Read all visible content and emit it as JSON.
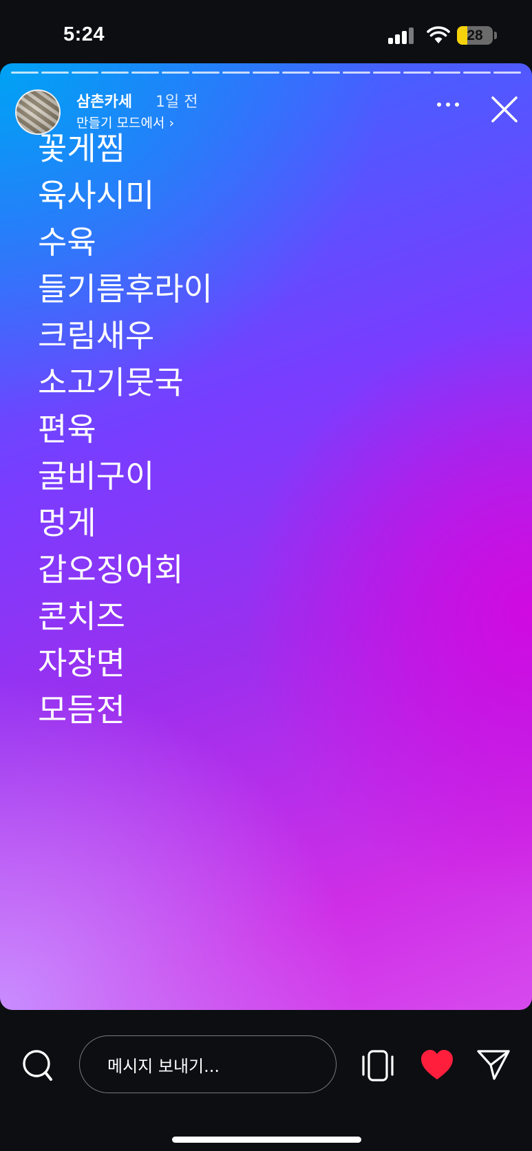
{
  "status_bar": {
    "time": "5:24",
    "battery_level": "28",
    "battery_fraction": 0.28,
    "battery_color": "#f5d20b",
    "icons": [
      "cellular-signal-icon",
      "wifi-icon",
      "battery-icon"
    ]
  },
  "story": {
    "segments": 17,
    "username": "삼촌카세",
    "time_ago": "1일 전",
    "create_mode": "만들기 모드에서 ›",
    "menu": [
      "꽃게찜",
      "육사시미",
      "수육",
      "들기름후라이",
      "크림새우",
      "소고기뭇국",
      "편육",
      "굴비구이",
      "멍게",
      "갑오징어회",
      "콘치즈",
      "자장면",
      "모듬전"
    ],
    "icons": [
      "more-icon",
      "close-icon"
    ],
    "gradient_colors": [
      "#00a2f4",
      "#7a3cff",
      "#d00ae0",
      "#c88dff"
    ]
  },
  "bottom_bar": {
    "message_placeholder": "메시지 보내기...",
    "icons": [
      "search-icon",
      "remix-icon",
      "heart-icon",
      "send-icon"
    ],
    "heart_color": "#ff1f3d"
  }
}
